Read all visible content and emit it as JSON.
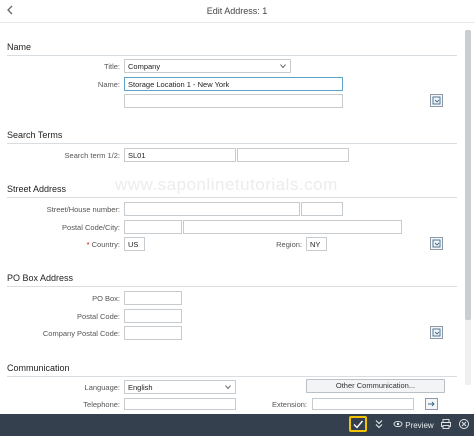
{
  "header": {
    "title": "Edit Address:  1",
    "back_icon": "back-arrow-icon"
  },
  "name_section": {
    "title": "Name",
    "title_label": "Title:",
    "title_value": "Company",
    "name_label": "Name:",
    "name_value": "Storage Location 1 - New York",
    "name2_value": ""
  },
  "search_section": {
    "title": "Search Terms",
    "label": "Search term 1/2:",
    "term1": "SL01",
    "term2": ""
  },
  "street_section": {
    "title": "Street Address",
    "street_label": "Street/House number:",
    "street_value": "",
    "house_value": "",
    "postal_label": "Postal Code/City:",
    "postal_value": "",
    "city_value": "",
    "country_label": "Country:",
    "country_required": "*",
    "country_value": "US",
    "region_label": "Region:",
    "region_value": "NY"
  },
  "pobox_section": {
    "title": "PO Box Address",
    "pobox_label": "PO Box:",
    "postal_label": "Postal Code:",
    "company_postal_label": "Company Postal Code:"
  },
  "comm_section": {
    "title": "Communication",
    "language_label": "Language:",
    "language_value": "English",
    "other_button": "Other Communication...",
    "telephone_label": "Telephone:",
    "extension_label": "Extension:"
  },
  "footer": {
    "confirm_icon": "checkmark-icon",
    "expand_icon": "double-chevron-down-icon",
    "preview_label": "Preview",
    "colors": {
      "bar": "#34404d",
      "highlight": "#f2c300"
    }
  },
  "watermark": "www.saponlinetutorials.com"
}
